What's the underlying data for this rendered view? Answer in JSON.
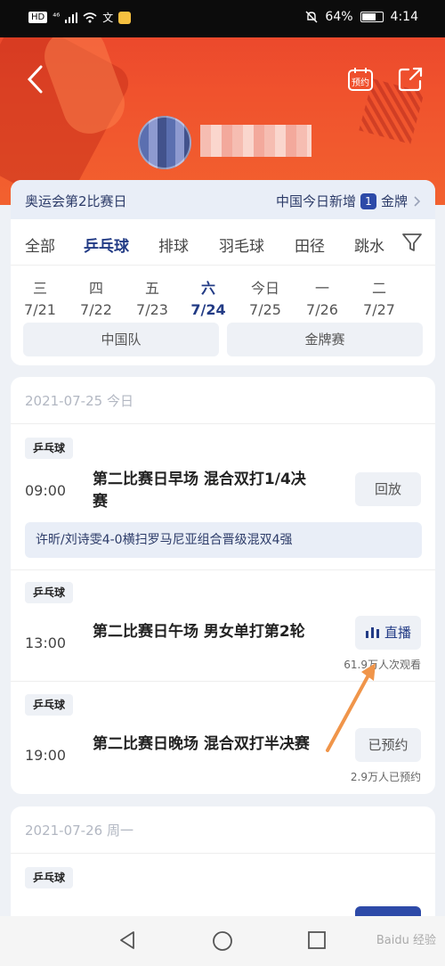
{
  "status_bar": {
    "chip": "HD",
    "signal": "⁴⁶",
    "time": "4:14",
    "battery": "64%"
  },
  "header": {
    "back_icon": "chevron-left-icon",
    "reminder_label": "预约",
    "share_icon": "share-icon"
  },
  "banner": {
    "left_text": "奥运会第2比赛日",
    "right_text": "中国今日新增",
    "medal_count": "1",
    "medal_label": "金牌"
  },
  "sport_tabs": [
    {
      "label": "全部"
    },
    {
      "label": "乒乓球"
    },
    {
      "label": "排球"
    },
    {
      "label": "羽毛球"
    },
    {
      "label": "田径"
    },
    {
      "label": "跳水"
    }
  ],
  "active_tab": "乒乓球",
  "dates": [
    {
      "day": "三",
      "date": "7/21"
    },
    {
      "day": "四",
      "date": "7/22"
    },
    {
      "day": "五",
      "date": "7/23"
    },
    {
      "day": "六",
      "date": "7/24"
    },
    {
      "day": "今日",
      "date": "7/25"
    },
    {
      "day": "一",
      "date": "7/26"
    },
    {
      "day": "二",
      "date": "7/27"
    }
  ],
  "active_date": "7/24",
  "segments": {
    "left": "中国队",
    "right": "金牌赛"
  },
  "schedule": {
    "day_header": "2021-07-25  今日",
    "events": [
      {
        "tag": "乒乓球",
        "time": "09:00",
        "title": "第二比赛日早场 混合双打1/4决赛",
        "action": "回放",
        "result": "许昕/刘诗雯4-0横扫罗马尼亚组合晋级混双4强"
      },
      {
        "tag": "乒乓球",
        "time": "13:00",
        "title": "第二比赛日午场 男女单打第2轮",
        "action": "直播",
        "sub": "61.9万人次观看"
      },
      {
        "tag": "乒乓球",
        "time": "19:00",
        "title": "第二比赛日晚场 混合双打半决赛",
        "action": "已预约",
        "sub": "2.9万人已预约"
      }
    ]
  },
  "next_day": {
    "day_header": "2021-07-26  周一",
    "tag": "乒乓球"
  },
  "watermark": "Baidu 经验",
  "colors": {
    "brand_red": "#e8432c",
    "accent_blue": "#223b85",
    "arrow_orange": "#f0954a"
  }
}
